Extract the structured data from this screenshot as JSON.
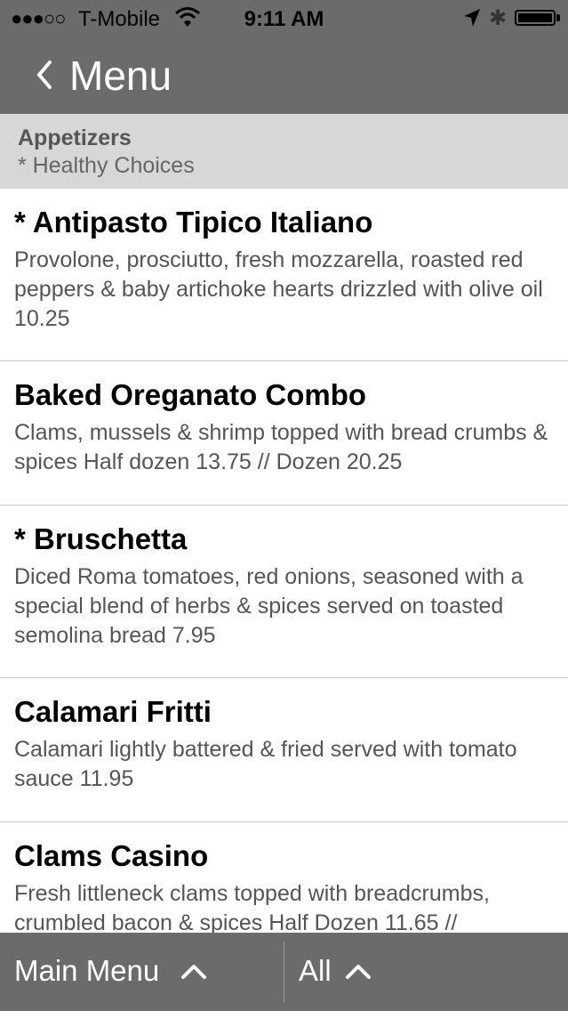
{
  "status_bar": {
    "signal": "●●●○○",
    "carrier": "T-Mobile",
    "time": "9:11 AM",
    "bluetooth_glyph": "✱",
    "icons": [
      "wifi-icon",
      "location-arrow-icon",
      "bluetooth-icon",
      "battery-icon"
    ]
  },
  "nav": {
    "title": "Menu",
    "back_icon": "chevron-left-icon"
  },
  "section": {
    "title": "Appetizers",
    "subtitle": "* Healthy Choices"
  },
  "items": [
    {
      "name": "* Antipasto Tipico Italiano",
      "description": "Provolone, prosciutto, fresh mozzarella, roasted red peppers & baby artichoke hearts drizzled with olive oil 10.25"
    },
    {
      "name": "Baked Oreganato Combo",
      "description": "Clams, mussels & shrimp topped with bread crumbs & spices Half dozen 13.75 // Dozen 20.25"
    },
    {
      "name": "* Bruschetta",
      "description": "Diced Roma tomatoes, red onions, seasoned with a special blend of herbs & spices served on toasted semolina bread 7.95"
    },
    {
      "name": "Calamari Fritti",
      "description": "Calamari lightly battered & fried served with tomato sauce 11.95"
    },
    {
      "name": "Clams Casino",
      "description": "Fresh littleneck clams topped with breadcrumbs, crumbled bacon & spices Half Dozen 11.65 //"
    }
  ],
  "bottom_bar": {
    "main_menu_label": "Main Menu",
    "all_label": "All",
    "chevron_icon": "chevron-up-icon"
  },
  "colors": {
    "bar_background": "#6b6b6b",
    "section_background": "#d7d7d7",
    "text_primary": "#000000",
    "text_secondary": "#555555",
    "bar_text": "#ffffff"
  }
}
